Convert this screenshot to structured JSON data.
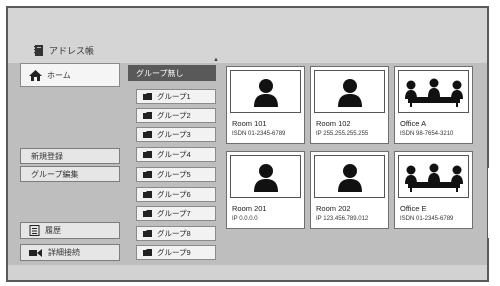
{
  "window": {
    "title": "アドレス帳"
  },
  "sidebar": {
    "home_label": "ホーム",
    "new_register_label": "新規登録",
    "group_edit_label": "グループ編集",
    "history_label": "履歴",
    "detail_connect_label": "詳細接続"
  },
  "groups": {
    "header_label": "グループ無し",
    "items": [
      "グループ1",
      "グループ2",
      "グループ3",
      "グループ4",
      "グループ5",
      "グループ6",
      "グループ7",
      "グループ8",
      "グループ9"
    ]
  },
  "contacts": [
    {
      "name": "Room 101",
      "address": "ISDN 01-2345-6789",
      "icon": "single-person-icon"
    },
    {
      "name": "Room 102",
      "address": "IP 255.255.255.255",
      "icon": "single-person-icon"
    },
    {
      "name": "Office A",
      "address": "ISDN 98-7654-3210",
      "icon": "group-meeting-icon"
    },
    {
      "name": "Room 201",
      "address": "IP 0.0.0.0",
      "icon": "single-person-icon"
    },
    {
      "name": "Room 202",
      "address": "IP 123.456.789.012",
      "icon": "single-person-icon"
    },
    {
      "name": "Office E",
      "address": "ISDN 01-2345-6789",
      "icon": "group-meeting-icon"
    }
  ]
}
